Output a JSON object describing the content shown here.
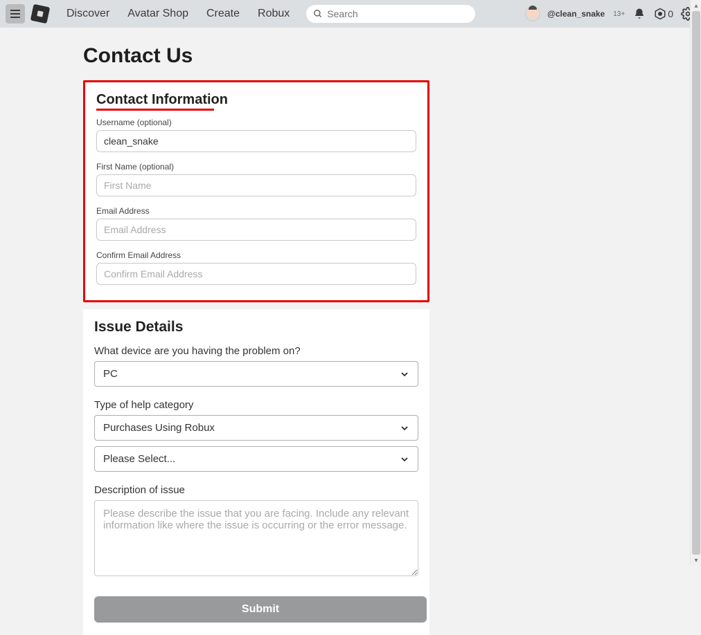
{
  "nav": {
    "links": [
      "Discover",
      "Avatar Shop",
      "Create",
      "Robux"
    ],
    "search_placeholder": "Search",
    "username": "@clean_snake",
    "age_badge": "13+",
    "robux_count": "0"
  },
  "page": {
    "title": "Contact Us"
  },
  "contact_section": {
    "heading": "Contact Information",
    "username_label": "Username (optional)",
    "username_value": "clean_snake",
    "firstname_label": "First Name (optional)",
    "firstname_placeholder": "First Name",
    "email_label": "Email Address",
    "email_placeholder": "Email Address",
    "confirm_email_label": "Confirm Email Address",
    "confirm_email_placeholder": "Confirm Email Address"
  },
  "issue_section": {
    "heading": "Issue Details",
    "device_label": "What device are you having the problem on?",
    "device_value": "PC",
    "category_label": "Type of help category",
    "category_value": "Purchases Using Robux",
    "subcategory_value": "Please Select...",
    "description_label": "Description of issue",
    "description_placeholder": "Please describe the issue that you are facing. Include any relevant information like where the issue is occurring or the error message.",
    "submit_label": "Submit"
  }
}
